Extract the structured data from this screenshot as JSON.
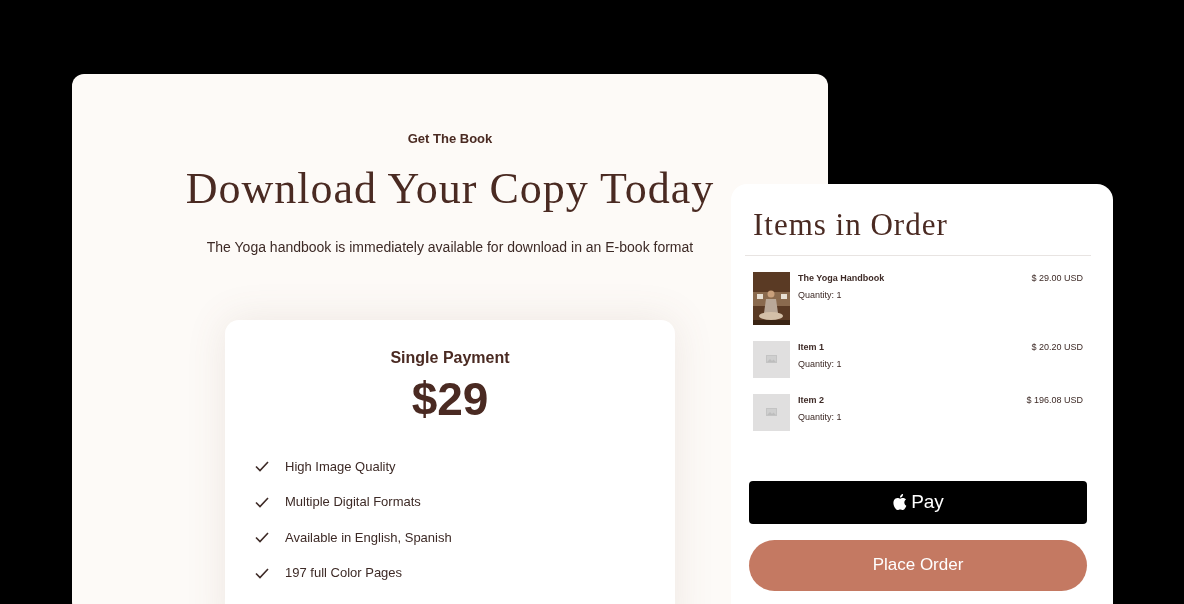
{
  "hero": {
    "eyebrow": "Get The Book",
    "title": "Download Your Copy Today",
    "subtitle": "The Yoga handbook is immediately available for download in an E-book format"
  },
  "pricing": {
    "plan": "Single Payment",
    "price": "$29",
    "features": [
      "High Image Quality",
      "Multiple Digital Formats",
      "Available in English, Spanish",
      "197 full Color Pages"
    ]
  },
  "order": {
    "title": "Items in Order",
    "items": [
      {
        "kind": "picture",
        "name": "The Yoga Handbook",
        "quantity": "Quantity: 1",
        "price": "$ 29.00 USD"
      },
      {
        "kind": "placeholder",
        "name": "Item 1",
        "quantity": "Quantity: 1",
        "price": "$ 20.20 USD"
      },
      {
        "kind": "placeholder",
        "name": "Item 2",
        "quantity": "Quantity: 1",
        "price": "$ 196.08 USD"
      }
    ],
    "pay_button": "Pay",
    "submit_button": "Place Order"
  }
}
